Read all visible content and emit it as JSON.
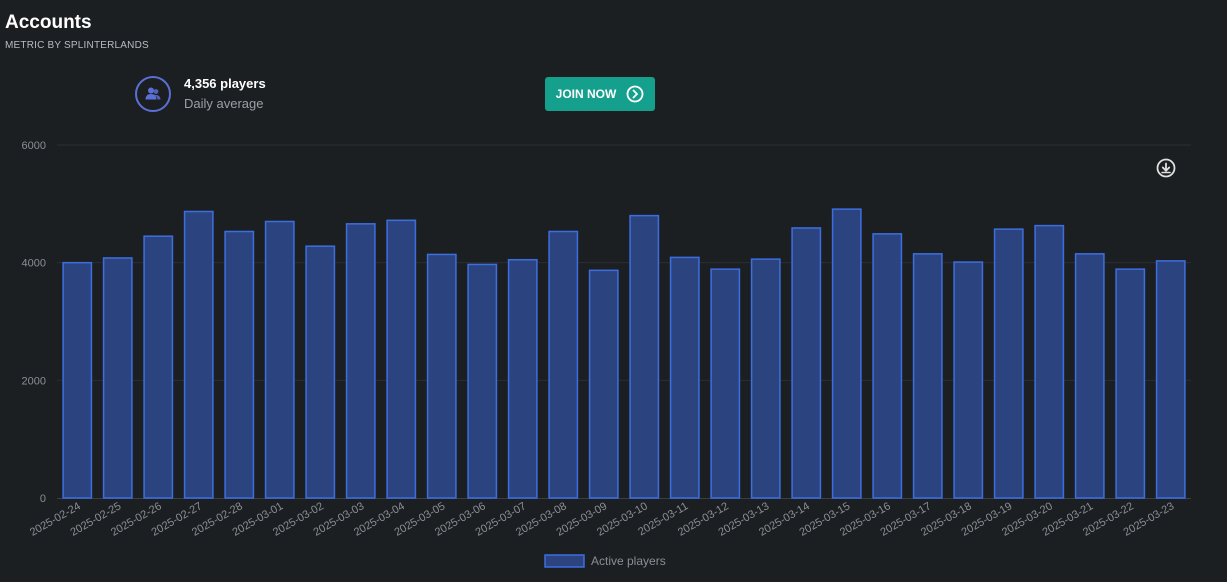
{
  "header": {
    "title": "Accounts",
    "subtitle": "METRIC BY SPLINTERLANDS"
  },
  "stat": {
    "icon": "users-icon",
    "value": "4,356 players",
    "label": "Daily average"
  },
  "join_button": {
    "label": "JOIN NOW",
    "icon": "chevron-right-circle-icon"
  },
  "download": {
    "icon": "download-icon"
  },
  "colors": {
    "bar_fill": "#2b4480",
    "bar_stroke": "#3d6ee0",
    "accent": "#14a08c",
    "icon_ring": "#5b6fd6"
  },
  "chart_data": {
    "type": "bar",
    "title": "",
    "xlabel": "",
    "ylabel": "",
    "ylim": [
      0,
      6000
    ],
    "yticks": [
      0,
      2000,
      4000,
      6000
    ],
    "grid": true,
    "legend_position": "bottom",
    "categories": [
      "2025-02-24",
      "2025-02-25",
      "2025-02-26",
      "2025-02-27",
      "2025-02-28",
      "2025-03-01",
      "2025-03-02",
      "2025-03-03",
      "2025-03-04",
      "2025-03-05",
      "2025-03-06",
      "2025-03-07",
      "2025-03-08",
      "2025-03-09",
      "2025-03-10",
      "2025-03-11",
      "2025-03-12",
      "2025-03-13",
      "2025-03-14",
      "2025-03-15",
      "2025-03-16",
      "2025-03-17",
      "2025-03-18",
      "2025-03-19",
      "2025-03-20",
      "2025-03-21",
      "2025-03-22",
      "2025-03-23"
    ],
    "series": [
      {
        "name": "Active players",
        "values": [
          4000,
          4080,
          4450,
          4870,
          4530,
          4700,
          4280,
          4660,
          4720,
          4140,
          3970,
          4050,
          4530,
          3870,
          4800,
          4090,
          3890,
          4060,
          4590,
          4910,
          4490,
          4150,
          4010,
          4570,
          4630,
          4150,
          3890,
          4030
        ]
      }
    ]
  }
}
